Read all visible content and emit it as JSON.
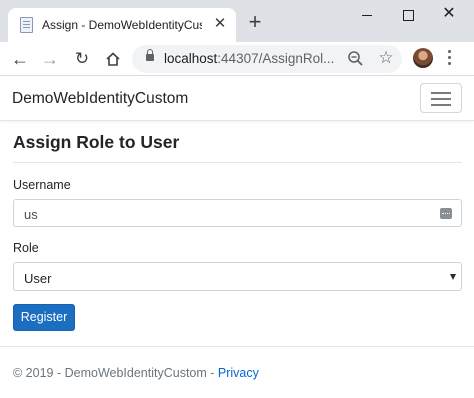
{
  "browser": {
    "tab_title": "Assign - DemoWebIdentityCusto",
    "tab_close": "✕",
    "new_tab": "+",
    "url_host": "localhost",
    "url_rest": ":44307/AssignRol...",
    "icons": {
      "back": "arrow-left-icon",
      "forward": "arrow-right-icon",
      "reload": "reload-icon",
      "home": "home-icon",
      "lock": "lock-icon",
      "zoom": "zoom-icon",
      "star": "star-icon",
      "menu": "kebab-menu-icon"
    }
  },
  "navbar": {
    "brand": "DemoWebIdentityCustom"
  },
  "page": {
    "title": "Assign Role to User",
    "username_label": "Username",
    "username_value": "us",
    "role_label": "Role",
    "role_selected": "User",
    "register_label": "Register"
  },
  "footer": {
    "copyright": "© 2019 - DemoWebIdentityCustom - ",
    "privacy_link": "Privacy"
  },
  "colors": {
    "primary_button": "#1b6ec2",
    "link": "#0366d6",
    "tabstrip": "#dee1e6"
  }
}
